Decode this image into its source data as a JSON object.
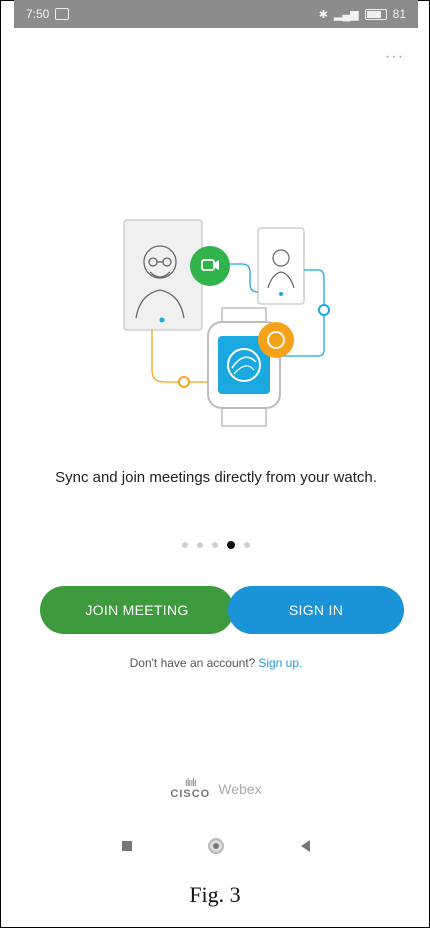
{
  "status_bar": {
    "time": "7:50",
    "battery": "81"
  },
  "menu": {
    "more_label": "···"
  },
  "onboarding": {
    "tagline": "Sync and join meetings directly from your watch.",
    "page_indicator": {
      "count": 5,
      "active_index": 3
    }
  },
  "actions": {
    "join_meeting_label": "JOIN MEETING",
    "sign_in_label": "SIGN IN"
  },
  "signup": {
    "prompt": "Don't have an account?",
    "link": "Sign up."
  },
  "brand": {
    "cisco": "CISCO",
    "product": "Webex"
  },
  "colors": {
    "join": "#3d9a3d",
    "sign_in": "#1a93d8",
    "link": "#2a9ad8",
    "illustration_green": "#2fb34a",
    "illustration_orange": "#f4a21a",
    "illustration_blue": "#19a9e0"
  },
  "figure_caption": "Fig. 3"
}
